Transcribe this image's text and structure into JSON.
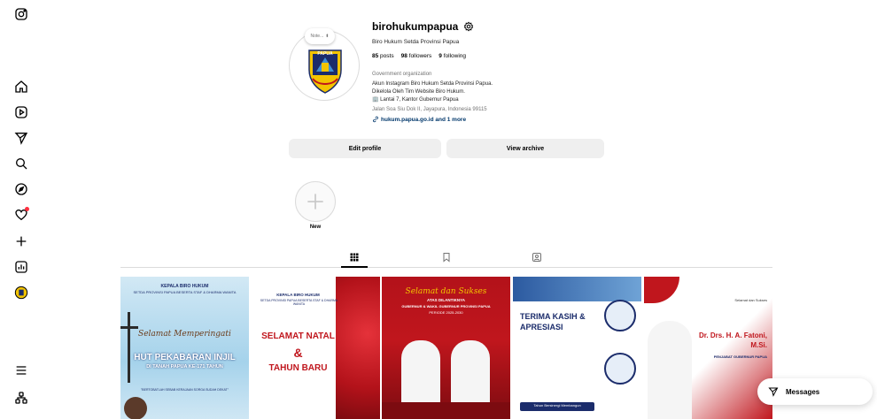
{
  "profile": {
    "username": "birohukumpapua",
    "full_name": "Biro Hukum Setda Provinsi Papua",
    "note_placeholder": "Note...",
    "avatar_text": "PAPUA",
    "stats": {
      "posts": "85",
      "posts_label": "posts",
      "followers": "98",
      "followers_label": "followers",
      "following": "9",
      "following_label": "following"
    },
    "category": "Government organization",
    "bio_line1": "Akun Instagram Biro Hukum Setda Provinsi Papua.",
    "bio_line2": "Dikelola Oleh Tim Website Biro Hukum.",
    "bio_line3": "🏢 Lantai 7, Kantor Gubernur Papua",
    "address": "Jalan Soa Siu Dok II, Jayapura, Indonesia 99115",
    "link": "hukum.papua.go.id and 1 more"
  },
  "buttons": {
    "edit_profile": "Edit profile",
    "view_archive": "View archive"
  },
  "highlight": {
    "label": "New"
  },
  "posts": [
    {
      "line1": "KEPALA BIRO HUKUM",
      "line2": "SETDA PROVINSI PAPUA BESERTA STAF & DHARMA WANITA",
      "script": "Selamat Memperingati",
      "title": "HUT PEKABARAN INJIL",
      "subtitle": "DI TANAH PAPUA KE-171 TAHUN",
      "footer": "\"BERTOBATLAH SEBAB KERAJAAN SORGA SUDAH DEKAT\""
    },
    {
      "line1": "KEPALA BIRO HUKUM",
      "line2": "SETDA PROVINSI PAPUA BESERTA STAF & DHARMA WANITA",
      "title": "SELAMAT NATAL",
      "amp": "&",
      "title2": "TAHUN BARU"
    },
    {
      "script": "Selamat dan Sukses",
      "line1": "ATAS DILANTIKNYA",
      "line2": "GUBERNUR & WAKIL GUBERNUR PROVINSI PAPUA",
      "line3": "PERIODE 2025-2030"
    },
    {
      "title": "TERIMA KASIH &",
      "title2": "APRESIASI",
      "footer": "Tahun Bersinergi Membangun"
    },
    {
      "line1": "Selamat dan Sukses",
      "title": "Dr. Drs. H. A. Fatoni,",
      "title2": "M.Si.",
      "line2": "PENJABAT GUBERNUR PAPUA"
    }
  ],
  "messages": {
    "label": "Messages"
  },
  "colors": {
    "link": "#00376b",
    "button_bg": "#efefef",
    "red": "#c0161d",
    "navy": "#1b2c6b"
  }
}
